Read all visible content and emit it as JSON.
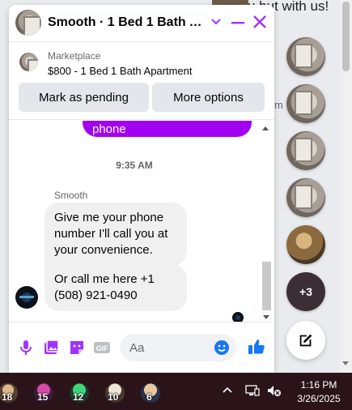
{
  "background": {
    "top_text": "u but with us!",
    "side_text": "m"
  },
  "chat": {
    "title": "Smooth · 1 Bed 1 Bath Apartment",
    "marketplace_label": "Marketplace",
    "listing": "$800 - 1 Bed 1 Bath Apartment",
    "mark_pending_label": "Mark as pending",
    "more_options_label": "More options",
    "sent_fragment": "phone",
    "timestamp": "9:35 AM",
    "sender_name": "Smooth",
    "messages": [
      "Give me your phone number I'll call you at your convenience.",
      "Or call me here +1 (508) 921-0490"
    ],
    "composer_placeholder": "Aa"
  },
  "chat_heads": {
    "more_count": "+3"
  },
  "taskbar": {
    "badges": [
      "18",
      "15",
      "12",
      "10",
      "6"
    ],
    "time": "1:16 PM",
    "date": "3/26/2025"
  },
  "colors": {
    "accent": "#a100f2",
    "like_blue": "#0084ff",
    "messenger_purple": "#a033ff"
  }
}
